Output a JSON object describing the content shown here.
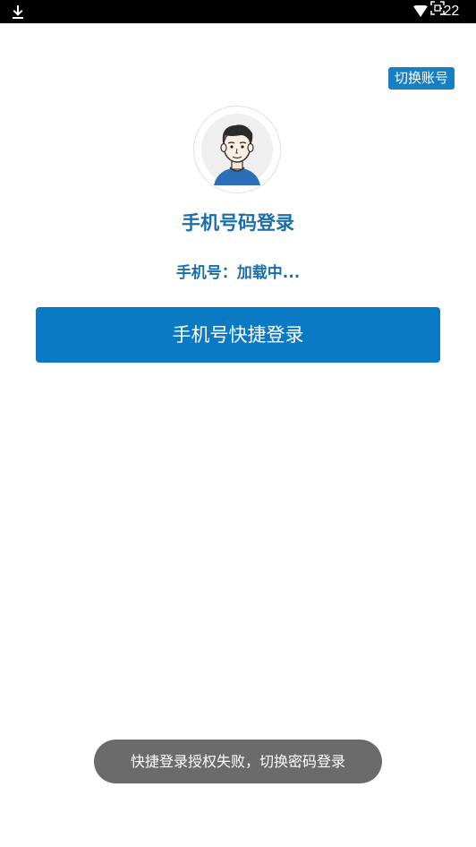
{
  "status_bar": {
    "time": ":22",
    "icons": [
      "download-icon",
      "wifi-icon",
      "screenshot-icon"
    ]
  },
  "header": {
    "switch_account_label": "切换账号"
  },
  "login": {
    "title": "手机号码登录",
    "phone_text": "手机号：加载中...",
    "quick_login_label": "手机号快捷登录"
  },
  "toast": {
    "message": "快捷登录授权失败，切换密码登录"
  },
  "colors": {
    "accent": "#0a7ac4",
    "title_text": "#1a6faa",
    "toast_bg": "#6b6b6b"
  }
}
